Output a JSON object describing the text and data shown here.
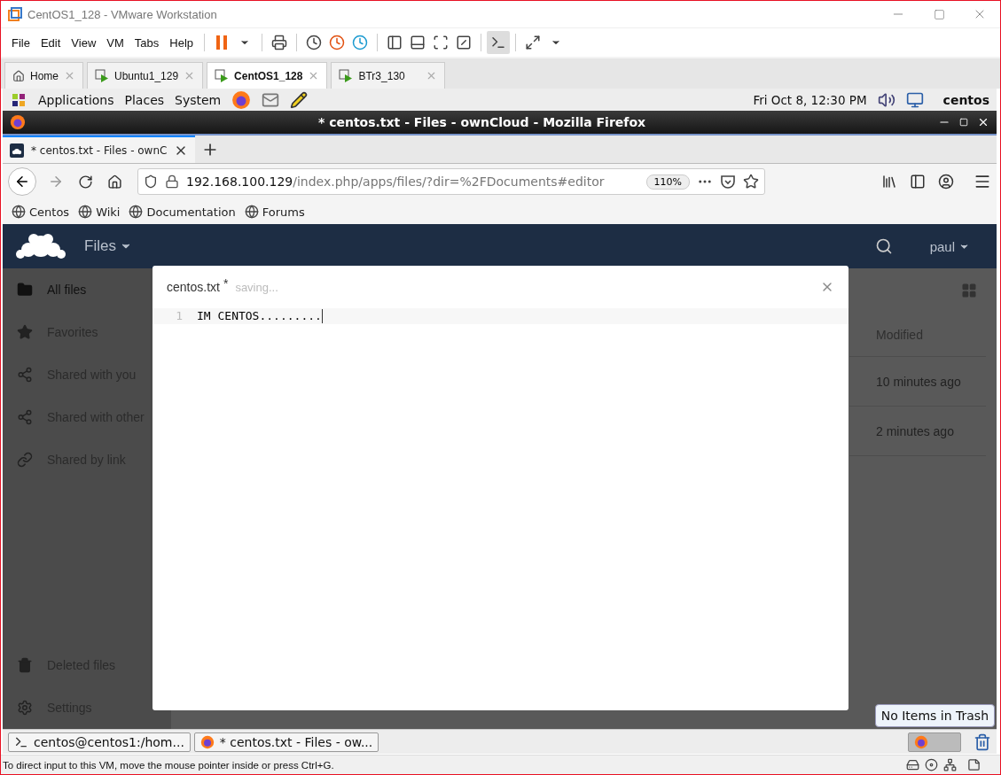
{
  "vmware": {
    "title": "CentOS1_128 - VMware Workstation",
    "menu": [
      "File",
      "Edit",
      "View",
      "VM",
      "Tabs",
      "Help"
    ],
    "tabs": [
      {
        "label": "Home",
        "kind": "home",
        "selected": false
      },
      {
        "label": "Ubuntu1_129",
        "kind": "vm",
        "selected": false
      },
      {
        "label": "CentOS1_128",
        "kind": "vm",
        "selected": true
      },
      {
        "label": "BTr3_130",
        "kind": "vm",
        "selected": false
      }
    ]
  },
  "gnome_panel": {
    "menu": [
      "Applications",
      "Places",
      "System"
    ],
    "clock": "Fri Oct  8, 12:30 PM",
    "user": "centos"
  },
  "firefox": {
    "title": "* centos.txt - Files - ownCloud - Mozilla Firefox",
    "tab": "* centos.txt - Files - ownC",
    "url_host": "192.168.100.129",
    "url_path": "/index.php/apps/files/?dir=%2FDocuments#editor",
    "zoom": "110%",
    "bookmarks": [
      "Centos",
      "Wiki",
      "Documentation",
      "Forums"
    ]
  },
  "owncloud": {
    "app": "Files",
    "user": "paul",
    "sidebar": [
      {
        "label": "All files",
        "kind": "folder",
        "selected": true
      },
      {
        "label": "Favorites",
        "kind": "star",
        "selected": false
      },
      {
        "label": "Shared with you",
        "kind": "share",
        "selected": false
      },
      {
        "label": "Shared with other",
        "kind": "share",
        "selected": false
      },
      {
        "label": "Shared by link",
        "kind": "link",
        "selected": false
      }
    ],
    "sidebar_bottom": [
      {
        "label": "Deleted files",
        "kind": "trash"
      },
      {
        "label": "Settings",
        "kind": "gear"
      }
    ],
    "column": "Modified",
    "rows": [
      {
        "modified": "10 minutes ago"
      },
      {
        "modified": "2 minutes ago"
      }
    ]
  },
  "editor": {
    "filename": "centos.txt",
    "modified_mark": "*",
    "status": "saving...",
    "lines": [
      {
        "number": "1",
        "text": "IM CENTOS........."
      }
    ]
  },
  "taskbar": [
    {
      "label": "centos@centos1:/hom...",
      "kind": "terminal"
    },
    {
      "label": "* centos.txt - Files - ow...",
      "kind": "browser"
    }
  ],
  "tooltip": "No Items in Trash",
  "status_bar": "To direct input to this VM, move the mouse pointer inside or press Ctrl+G."
}
